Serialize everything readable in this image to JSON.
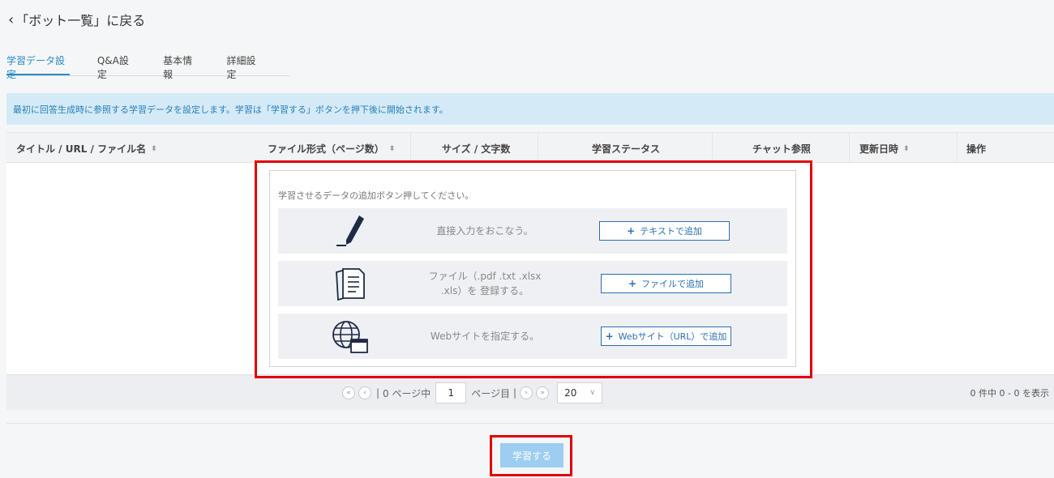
{
  "nav": {
    "back_label": "「ボット一覧」に戻る"
  },
  "tabs": [
    {
      "label": "学習データ設定",
      "active": true
    },
    {
      "label": "Q&A設定"
    },
    {
      "label": "基本情報"
    },
    {
      "label": "詳細設定"
    }
  ],
  "banner": {
    "text": "最初に回答生成時に参照する学習データを設定します。学習は「学習する」ボタンを押下後に開始されます。"
  },
  "table": {
    "columns": [
      "タイトル / URL / ファイル名",
      "ファイル形式（ページ数）",
      "サイズ / 文字数",
      "学習ステータス",
      "チャット参照",
      "更新日時",
      "操作"
    ]
  },
  "add_panel": {
    "prompt": "学習させるデータの追加ボタン押してください。",
    "options": [
      {
        "icon": "pen-icon",
        "description": "直接入力をおこなう。",
        "button_label": "テキストで追加"
      },
      {
        "icon": "documents-icon",
        "description_line1": "ファイル（.pdf .txt .xlsx",
        "description_line2": ".xls）を 登録する。",
        "button_label": "ファイルで追加"
      },
      {
        "icon": "globe-window-icon",
        "description": "Webサイトを指定する。",
        "button_label": "Webサイト（URL）で追加"
      }
    ]
  },
  "pager": {
    "first": "«",
    "prev": "‹",
    "total_pages_text": "0 ページ中",
    "current_page": "1",
    "page_suffix": "ページ目",
    "next": "›",
    "last": "»",
    "per_page": "20",
    "count_text": "0 件中 0 - 0 を表示"
  },
  "actions": {
    "learn_label": "学習する"
  },
  "colors": {
    "accent": "#2a8bc6",
    "highlight": "#e00000",
    "learn_button": "#9dcdf0"
  }
}
